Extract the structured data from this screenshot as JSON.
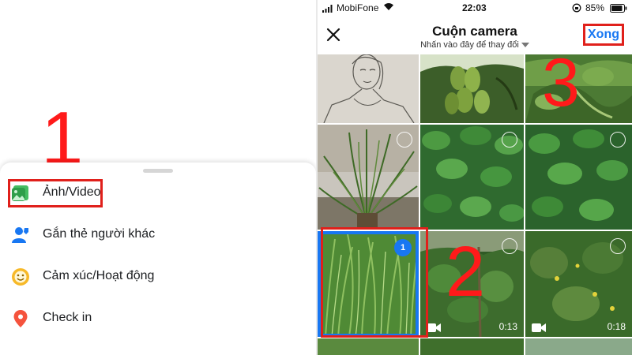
{
  "left_panel": {
    "step_number": "1",
    "menu": [
      {
        "label": "Ảnh/Video"
      },
      {
        "label": "Gắn thẻ người khác"
      },
      {
        "label": "Cảm xúc/Hoạt động"
      },
      {
        "label": "Check in"
      }
    ]
  },
  "right_panel": {
    "status": {
      "carrier": "MobiFone",
      "time": "22:03",
      "battery": "85%"
    },
    "title": "Cuộn camera",
    "subtitle": "Nhấn vào đây để thay đổi",
    "done_label": "Xong",
    "step_two": "2",
    "step_three": "3",
    "selected_badge": "1",
    "durations": [
      "0:13",
      "0:18"
    ]
  },
  "colors": {
    "accent": "#1877f2",
    "annotation": "#e0201b"
  }
}
